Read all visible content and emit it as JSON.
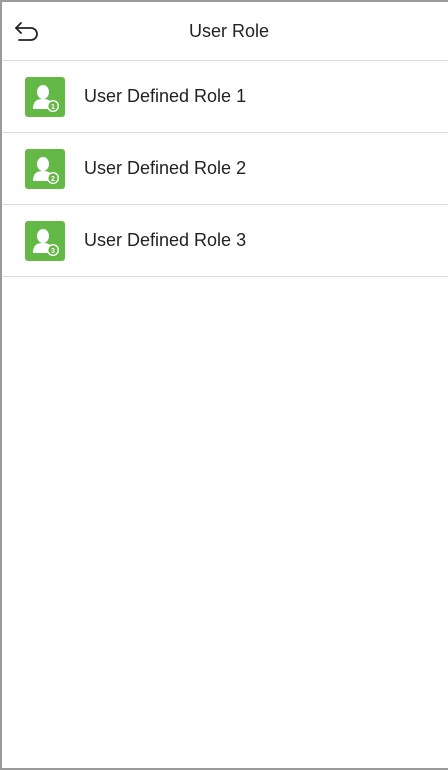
{
  "header": {
    "title": "User Role",
    "back_icon": "back-arrow-icon"
  },
  "roles": [
    {
      "label": "User Defined Role 1",
      "badge": "1",
      "icon": "user-role-icon"
    },
    {
      "label": "User Defined Role 2",
      "badge": "2",
      "icon": "user-role-icon"
    },
    {
      "label": "User Defined Role 3",
      "badge": "3",
      "icon": "user-role-icon"
    }
  ],
  "colors": {
    "icon_bg": "#64b946",
    "text": "#222222",
    "divider": "#dcdcdc"
  }
}
